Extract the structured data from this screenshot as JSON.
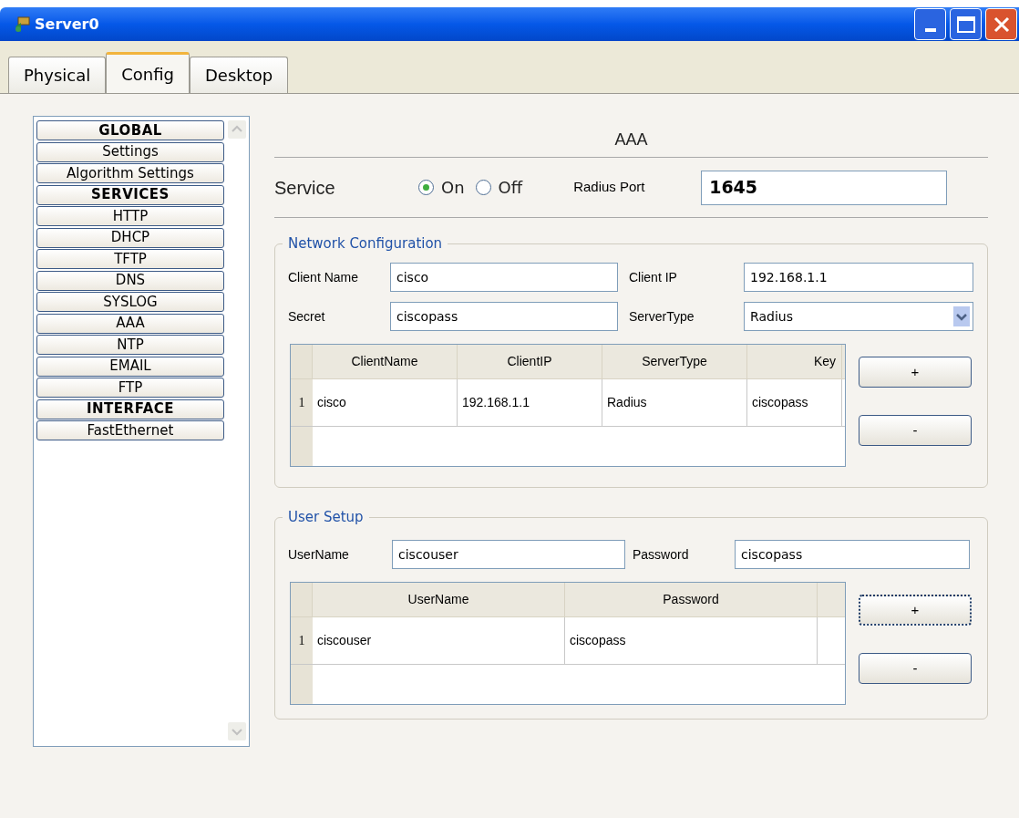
{
  "window": {
    "title": "Server0"
  },
  "tabs": [
    {
      "label": "Physical",
      "selected": false
    },
    {
      "label": "Config",
      "selected": true
    },
    {
      "label": "Desktop",
      "selected": false
    }
  ],
  "sidebar": {
    "items": [
      {
        "kind": "header",
        "label": "GLOBAL"
      },
      {
        "kind": "item",
        "label": "Settings"
      },
      {
        "kind": "item",
        "label": "Algorithm Settings"
      },
      {
        "kind": "header",
        "label": "SERVICES"
      },
      {
        "kind": "item",
        "label": "HTTP"
      },
      {
        "kind": "item",
        "label": "DHCP"
      },
      {
        "kind": "item",
        "label": "TFTP"
      },
      {
        "kind": "item",
        "label": "DNS"
      },
      {
        "kind": "item",
        "label": "SYSLOG"
      },
      {
        "kind": "item",
        "label": "AAA"
      },
      {
        "kind": "item",
        "label": "NTP"
      },
      {
        "kind": "item",
        "label": "EMAIL"
      },
      {
        "kind": "item",
        "label": "FTP"
      },
      {
        "kind": "header",
        "label": "INTERFACE"
      },
      {
        "kind": "item",
        "label": "FastEthernet"
      }
    ]
  },
  "panel": {
    "title": "AAA",
    "service": {
      "label": "Service",
      "options": [
        {
          "label": "On",
          "selected": true
        },
        {
          "label": "Off",
          "selected": false
        }
      ],
      "port_label": "Radius Port",
      "port_value": "1645"
    },
    "network_configuration": {
      "title": "Network Configuration",
      "fields": [
        {
          "kind": "text",
          "label": "Client Name",
          "value": "cisco"
        },
        {
          "kind": "text",
          "label": "Client IP",
          "value": "192.168.1.1"
        },
        {
          "kind": "text",
          "label": "Secret",
          "value": "ciscopass"
        },
        {
          "kind": "select",
          "label": "ServerType",
          "value": "Radius"
        }
      ],
      "table": {
        "columns": [
          "ClientName",
          "ClientIP",
          "ServerType",
          "Key"
        ],
        "rows": [
          {
            "index": "1",
            "cells": [
              "cisco",
              "192.168.1.1",
              "Radius",
              "ciscopass"
            ]
          }
        ]
      },
      "buttons": [
        {
          "label": "+",
          "focused": false
        },
        {
          "label": "-",
          "focused": false
        }
      ]
    },
    "user_setup": {
      "title": "User Setup",
      "fields": [
        {
          "kind": "text",
          "label": "UserName",
          "value": "ciscouser"
        },
        {
          "kind": "text",
          "label": "Password",
          "value": "ciscopass"
        }
      ],
      "table": {
        "columns": [
          "UserName",
          "Password"
        ],
        "rows": [
          {
            "index": "1",
            "cells": [
              "ciscouser",
              "ciscopass"
            ]
          }
        ]
      },
      "buttons": [
        {
          "label": "+",
          "focused": true
        },
        {
          "label": "-",
          "focused": false
        }
      ]
    }
  }
}
